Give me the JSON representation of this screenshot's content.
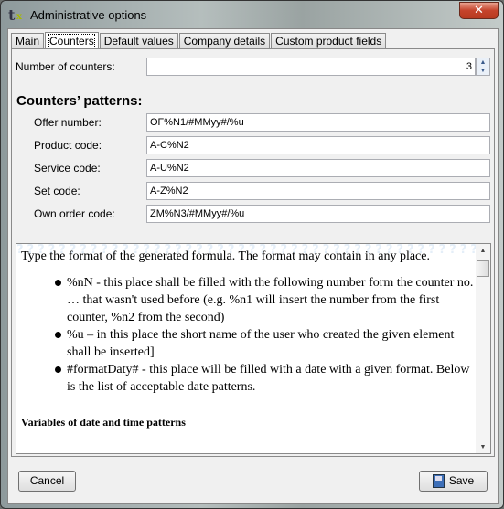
{
  "window": {
    "title": "Administrative options",
    "close_label": "✕"
  },
  "tabs": [
    {
      "label": "Main"
    },
    {
      "label": "Counters"
    },
    {
      "label": "Default values"
    },
    {
      "label": "Company details"
    },
    {
      "label": "Custom product fields"
    }
  ],
  "counters": {
    "number_label": "Number of counters:",
    "number_value": "3",
    "heading": "Counters’ patterns:",
    "fields": [
      {
        "label": "Offer number:",
        "value": "OF%N1/#MMyy#/%u"
      },
      {
        "label": "Product code:",
        "value": "A-C%N2"
      },
      {
        "label": "Service code:",
        "value": "A-U%N2"
      },
      {
        "label": "Set code:",
        "value": "A-Z%N2"
      },
      {
        "label": "Own order code:",
        "value": "ZM%N3/#MMyy#/%u"
      }
    ]
  },
  "help": {
    "intro": "Type the format of the generated formula. The format may contain in any place.",
    "items": [
      "%nN - this place shall be filled with the following number form the counter no. … that wasn't used before (e.g. %n1 will insert the number from the first counter, %n2 from the second)",
      "%u – in this place the short name of the user who created the given element shall be inserted]",
      "#formatDaty# - this place will be filled with a date with a given format. Below is the list of acceptable date patterns."
    ],
    "section": "Variables of date and time patterns"
  },
  "buttons": {
    "cancel": "Cancel",
    "save": "Save"
  }
}
